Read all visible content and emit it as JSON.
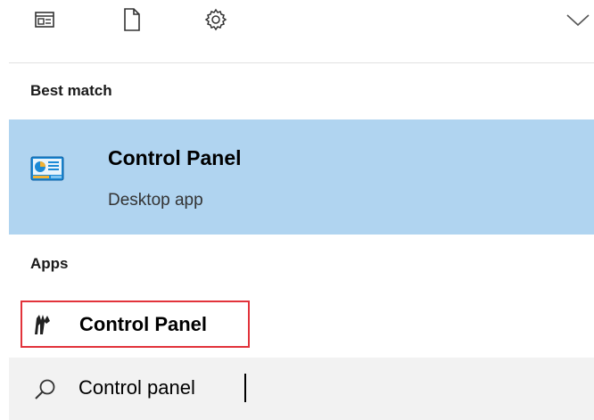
{
  "toolbar": {
    "apps_icon": "apps-filter-icon",
    "documents_icon": "document-icon",
    "settings_icon": "gear-icon",
    "expand_icon": "chevron-down-icon"
  },
  "best_match": {
    "header": "Best match",
    "title": "Control Panel",
    "subtitle": "Desktop app",
    "icon": "control-panel-icon",
    "highlight_color": "#b0d4f0"
  },
  "apps": {
    "header": "Apps",
    "items": [
      {
        "label": "Control Panel",
        "icon": "control-panel-app-icon"
      }
    ],
    "highlight_border_color": "#e2333b"
  },
  "search": {
    "value": "Control panel",
    "icon": "search-icon"
  }
}
